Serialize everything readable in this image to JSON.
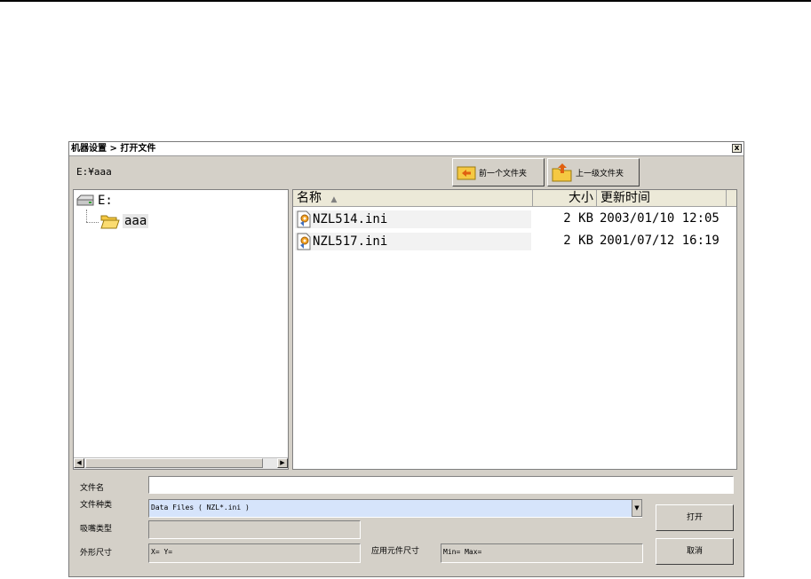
{
  "dialog": {
    "title": "机器设置 > 打开文件",
    "close_glyph": "x",
    "current_path": "E:¥aaa"
  },
  "toolbar": {
    "back_label": "前一个文件夹",
    "up_label": "上一级文件夹"
  },
  "tree": {
    "drive_label": "E:",
    "folder_label": "aaa"
  },
  "file_list": {
    "columns": [
      "名称",
      "大小",
      "更新时间"
    ],
    "sort_indicator": "▲",
    "rows": [
      {
        "name": "NZL514.ini",
        "size": "2 KB",
        "date": "2003/01/10 12:05"
      },
      {
        "name": "NZL517.ini",
        "size": "2 KB",
        "date": "2001/07/12 16:19"
      }
    ]
  },
  "form": {
    "filename_label": "文件名",
    "filename_value": "",
    "filetype_label": "文件种类",
    "filetype_value": "Data Files ( NZL*.ini )",
    "nozzle_label": "吸嘴类型",
    "nozzle_value": "",
    "size_label": "外形尺寸",
    "size_value": "X= Y=",
    "applied_label": "应用元件尺寸",
    "applied_value": "Min= Max="
  },
  "buttons": {
    "open_label": "打开",
    "cancel_label": "取消"
  },
  "colors": {
    "dialog_bg": "#d4d0c8",
    "combo_bg": "#d6e4fb",
    "folder_yellow": "#f5c842"
  }
}
